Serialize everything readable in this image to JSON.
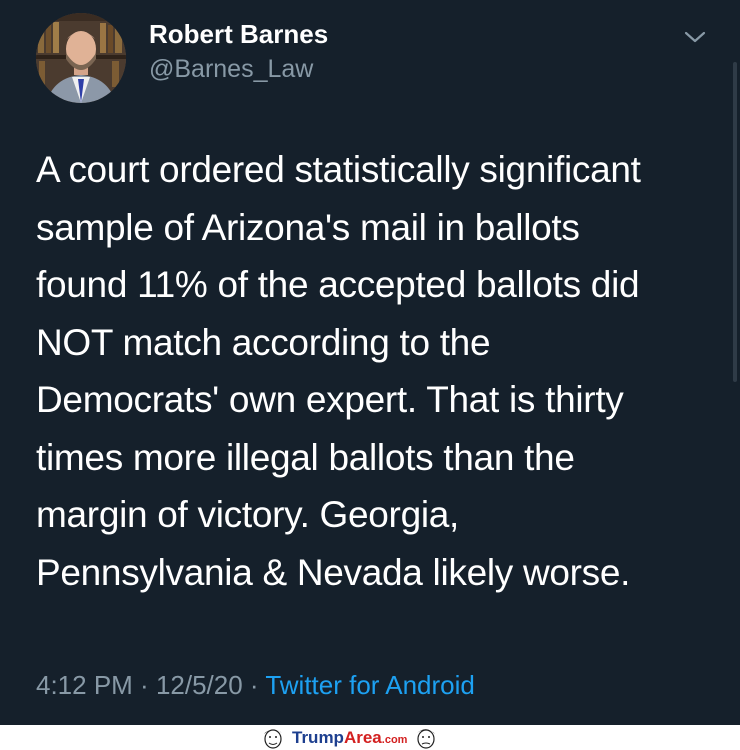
{
  "tweet": {
    "author_name": "Robert Barnes",
    "author_handle": "@Barnes_Law",
    "text": "A court ordered statistically significant\nsample of Arizona's mail in ballots\nfound 11% of the accepted ballots did\nNOT match according to the\nDemocrats' own expert. That is thirty\ntimes more illegal ballots than the\nmargin of victory. Georgia,\nPennsylvania & Nevada likely worse.",
    "time": "4:12 PM",
    "date": "12/5/20",
    "separator": " · ",
    "source": "Twitter for Android"
  },
  "watermark": {
    "part1": "Trump",
    "part2": "Area",
    "part3": ".com"
  },
  "colors": {
    "background": "#15202b",
    "secondary_text": "#8899a6",
    "link": "#1da1f2"
  },
  "icons": {
    "menu": "chevron-down-icon",
    "avatar": "profile-photo"
  }
}
